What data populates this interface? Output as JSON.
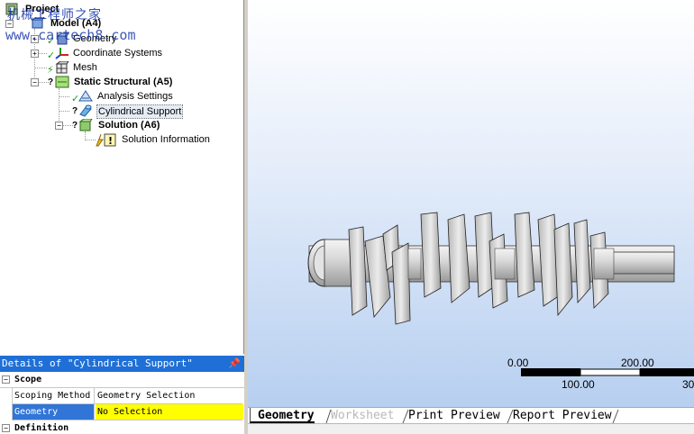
{
  "watermark": {
    "title": "机械工程师之家",
    "url": "www.cartech8.com"
  },
  "tree": {
    "project": "Project",
    "model": "Model (A4)",
    "geometry": "Geometry",
    "coordinate_systems": "Coordinate Systems",
    "mesh": "Mesh",
    "static_structural": "Static Structural (A5)",
    "analysis_settings": "Analysis Settings",
    "cylindrical_support": "Cylindrical Support",
    "solution": "Solution (A6)",
    "solution_information": "Solution Information",
    "question_mark": "?"
  },
  "details": {
    "title": "Details of \"Cylindrical Support\"",
    "pin_icon": "pin-icon",
    "scope_group": "Scope",
    "scoping_method_label": "Scoping Method",
    "scoping_method_value": "Geometry Selection",
    "geometry_label": "Geometry",
    "geometry_value": "No Selection",
    "definition_group": "Definition"
  },
  "scale": {
    "label_0": "0.00",
    "label_100": "100.00",
    "label_200": "200.00",
    "label_300": "30"
  },
  "tabs": {
    "geometry": "Geometry",
    "worksheet": "Worksheet",
    "print_preview": "Print Preview",
    "report_preview": "Report Preview"
  },
  "colors": {
    "selection_blue": "#1f6fd6",
    "highlight_yellow": "#ffff00",
    "check_green": "#1d9b1d",
    "view_gradient_bottom": "#b7cff0"
  }
}
